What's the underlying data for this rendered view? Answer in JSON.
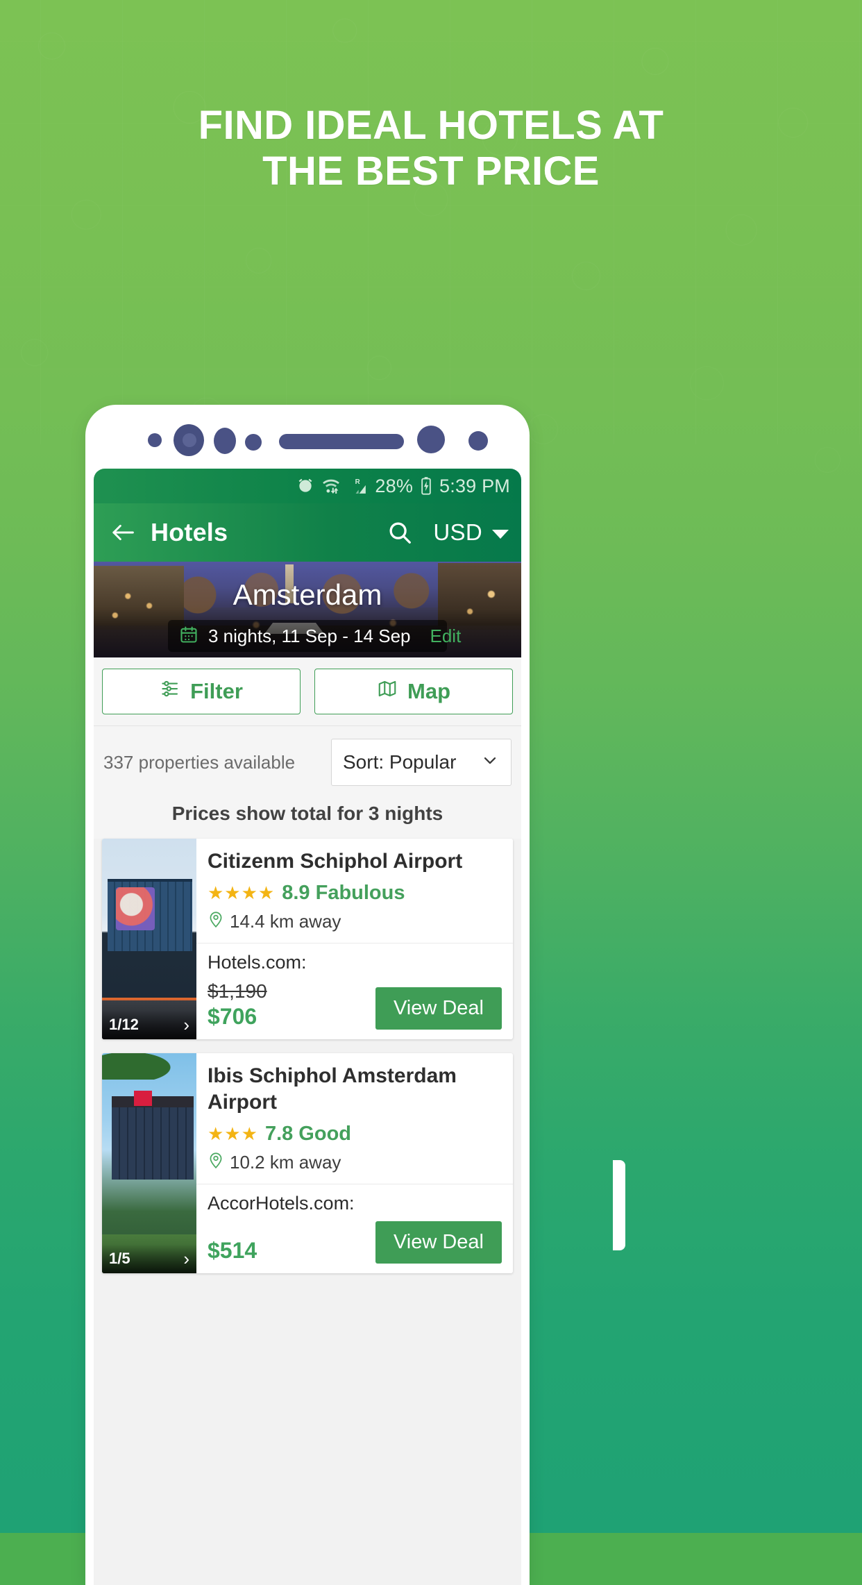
{
  "headline": {
    "line1": "FIND IDEAL HOTELS AT",
    "line2": "THE BEST PRICE"
  },
  "colors": {
    "bg_top": "#7cc254",
    "bg_bottom": "#1fa274",
    "brand_green": "#3f9d56",
    "appbar_green": "#0d8249",
    "score_green": "#44a05c",
    "star_yellow": "#f3b414",
    "bezel_navy": "#4a5285"
  },
  "status_bar": {
    "alarm_icon": "alarm-clock-icon",
    "wifi_icon": "wifi-icon",
    "signal_icon": "cell-signal-roaming-icon",
    "signal_label": "R",
    "battery_percent": "28%",
    "battery_icon": "battery-charging-icon",
    "time": "5:39 PM"
  },
  "appbar": {
    "back_icon": "back-arrow-icon",
    "title": "Hotels",
    "search_icon": "search-icon",
    "currency": "USD",
    "caret_icon": "chevron-down-icon"
  },
  "hero": {
    "city": "Amsterdam",
    "calendar_icon": "calendar-icon",
    "dates": "3 nights, 11 Sep - 14 Sep",
    "edit_label": "Edit"
  },
  "toolbar": {
    "filter_icon": "filter-sliders-icon",
    "filter_label": "Filter",
    "map_icon": "map-icon",
    "map_label": "Map"
  },
  "results": {
    "count_label": "337 properties available",
    "sort_label": "Sort: Popular",
    "sort_caret_icon": "chevron-down-icon",
    "price_note": "Prices show total for 3 nights"
  },
  "hotels": [
    {
      "name": "Citizenm Schiphol Airport",
      "stars": "★★★★",
      "star_count": 4,
      "score": "8.9 Fabulous",
      "distance_icon": "location-pin-icon",
      "distance": "14.4 km away",
      "photo_counter": "1/12",
      "photo_next_icon": "chevron-right-icon",
      "provider": "Hotels.com:",
      "price_old": "$1,190",
      "price_new": "$706",
      "deal_label": "View Deal"
    },
    {
      "name": "Ibis Schiphol Amsterdam Airport",
      "stars": "★★★",
      "star_count": 3,
      "score": "7.8 Good",
      "distance_icon": "location-pin-icon",
      "distance": "10.2 km away",
      "photo_counter": "1/5",
      "photo_next_icon": "chevron-right-icon",
      "provider": "AccorHotels.com:",
      "price_old": "",
      "price_new": "$514",
      "deal_label": "View Deal"
    }
  ]
}
